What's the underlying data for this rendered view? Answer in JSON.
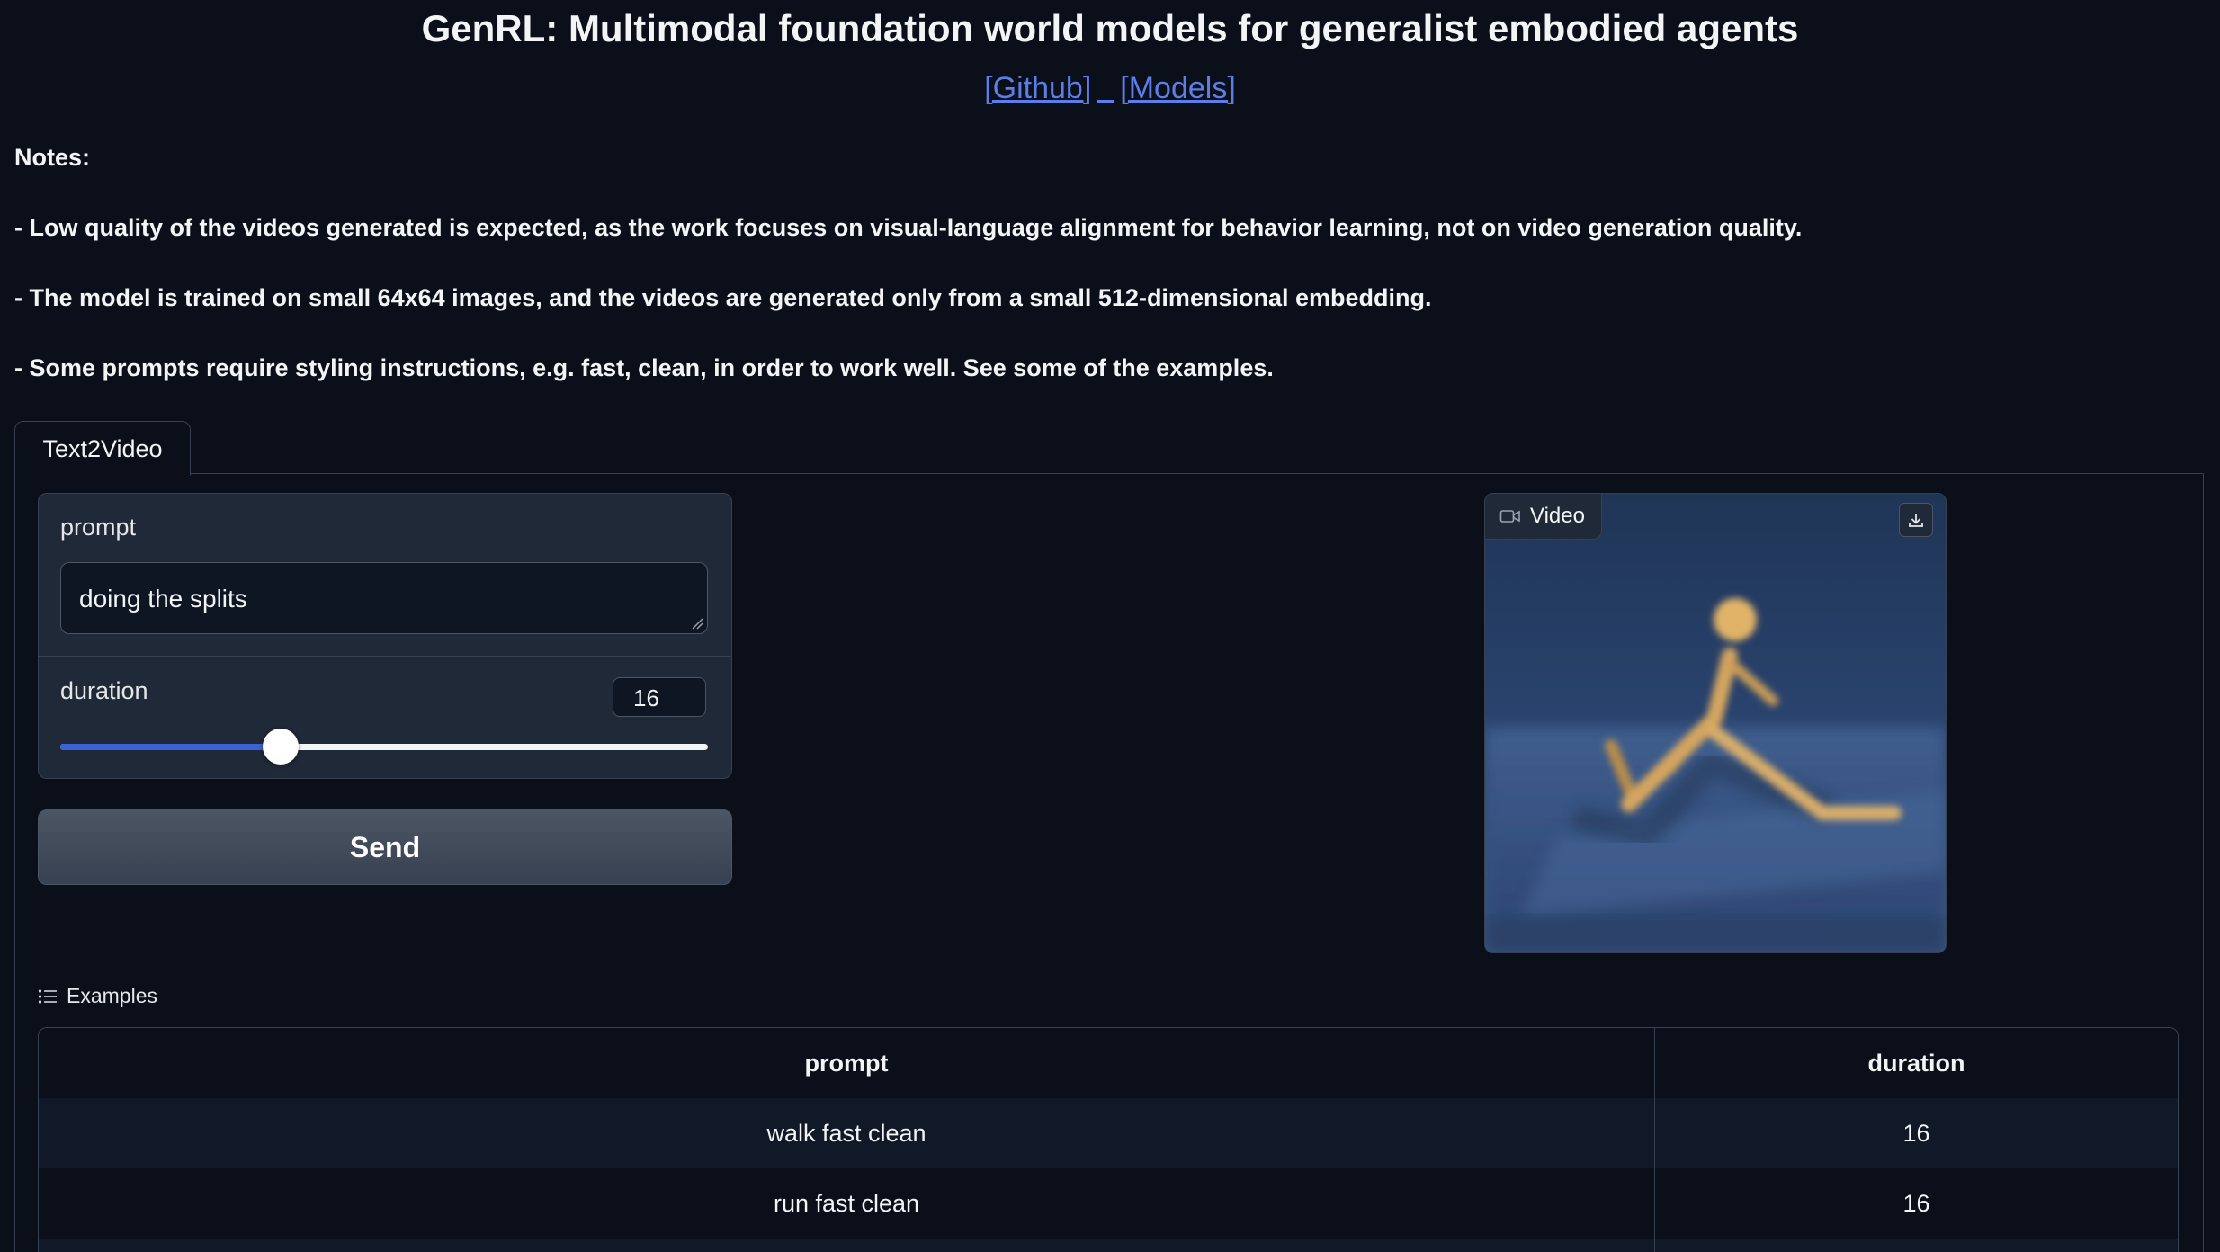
{
  "header": {
    "title": "GenRL: Multimodal foundation world models for generalist embodied agents",
    "links": [
      {
        "label": "[Github]"
      },
      {
        "label": "[Models]"
      }
    ]
  },
  "notes": {
    "heading": "Notes:",
    "items": [
      "- Low quality of the videos generated is expected, as the work focuses on visual-language alignment for behavior learning, not on video generation quality.",
      "- The model is trained on small 64x64 images, and the videos are generated only from a small 512-dimensional embedding.",
      "- Some prompts require styling instructions, e.g. fast, clean, in order to work well. See some of the examples."
    ]
  },
  "tabs": [
    {
      "label": "Text2Video",
      "selected": true
    }
  ],
  "form": {
    "prompt_label": "prompt",
    "prompt_value": "doing the splits",
    "duration_label": "duration",
    "duration_value": "16",
    "duration_slider_fraction": 0.34,
    "send_label": "Send"
  },
  "video": {
    "label": "Video",
    "icons": {
      "label_icon": "video-camera-icon",
      "download_icon": "download-icon"
    }
  },
  "examples": {
    "label": "Examples",
    "columns": [
      "prompt",
      "duration"
    ],
    "rows": [
      [
        "walk fast clean",
        "16"
      ],
      [
        "run fast clean",
        "16"
      ]
    ]
  },
  "colors": {
    "background": "#0b0f19",
    "panel": "#1f2937",
    "accent": "#3b63d6",
    "link": "#5b7ee8"
  }
}
